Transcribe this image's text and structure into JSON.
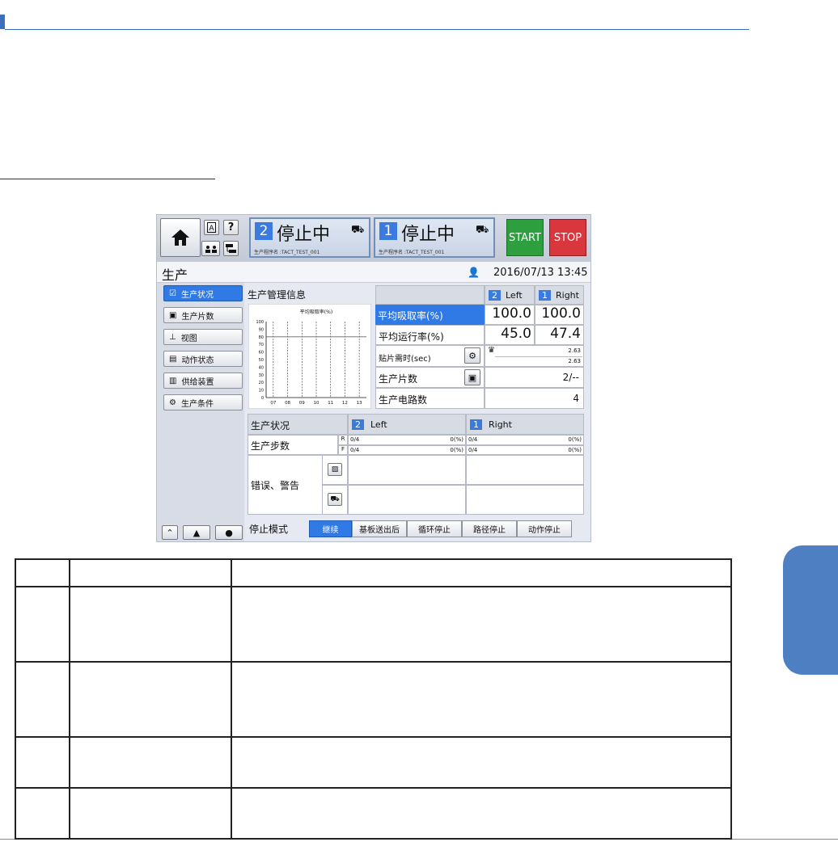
{
  "screen": {
    "machines": [
      {
        "number": "2",
        "status": "停止中",
        "program": "生产程序名 :TACT_TEST_001"
      },
      {
        "number": "1",
        "status": "停止中",
        "program": "生产程序名 :TACT_TEST_001"
      }
    ],
    "start_label": "START",
    "stop_label": "STOP",
    "title": "生产",
    "datetime": "2016/07/13 13:45",
    "menu": [
      "生产状况",
      "生产片数",
      "视图",
      "动作状态",
      "供给装置",
      "生产条件"
    ],
    "info": {
      "title": "生产管理信息",
      "lane_left_num": "2",
      "lane_left": "Left",
      "lane_right_num": "1",
      "lane_right": "Right",
      "pickup_label": "平均吸取率(%)",
      "pickup_left": "100.0",
      "pickup_right": "100.0",
      "operating_label": "平均运行率(%)",
      "operating_left": "45.0",
      "operating_right": "47.4",
      "mount_time_label": "贴片需时(sec)",
      "mount_time_1": "2.63",
      "mount_time_2": "2.63",
      "boards_label": "生产片数",
      "boards_value": "2/--",
      "circuits_label": "生产电路数",
      "circuits_value": "4"
    },
    "status": {
      "title": "生产状况",
      "left_num": "2",
      "left": "Left",
      "right_num": "1",
      "right": "Right",
      "steps_label": "生产步数",
      "row_r": "R",
      "row_f": "F",
      "r_left_count": "0/4",
      "r_left_pct": "0(%)",
      "r_right_count": "0/4",
      "r_right_pct": "0(%)",
      "f_left_count": "0/4",
      "f_left_pct": "0(%)",
      "f_right_count": "0/4",
      "f_right_pct": "0(%)",
      "errors_label": "错误、警告"
    },
    "stop_mode": {
      "label": "停止模式",
      "options": [
        "继续",
        "基板送出后",
        "循环停止",
        "路径停止",
        "动作停止"
      ],
      "selected": "继续"
    }
  },
  "chart_data": {
    "type": "line",
    "title": "平均吸取率(%)",
    "categories": [
      "07",
      "08",
      "09",
      "10",
      "11",
      "12",
      "13"
    ],
    "y_ticks": [
      "100",
      "90",
      "80",
      "70",
      "60",
      "50",
      "40",
      "30",
      "20",
      "10",
      "0"
    ],
    "ylim": [
      0,
      100
    ],
    "reference_line": 80,
    "series": [],
    "grid": true
  }
}
